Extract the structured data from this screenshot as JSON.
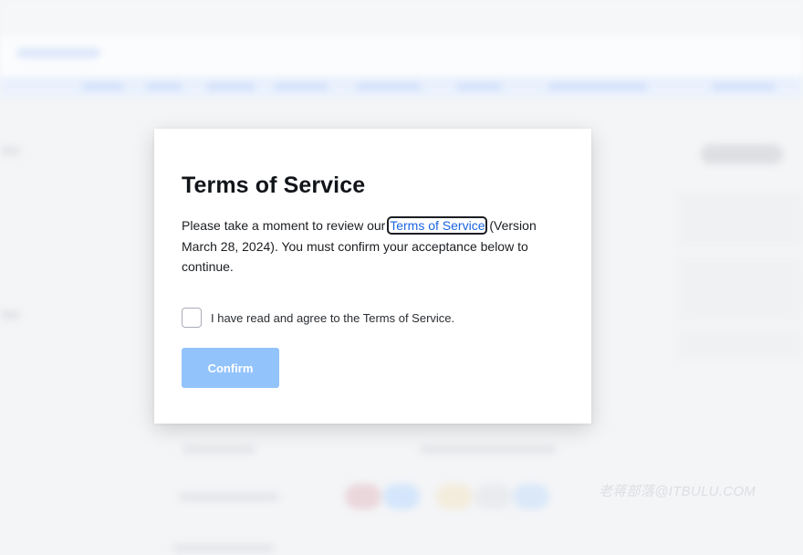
{
  "modal": {
    "title": "Terms of Service",
    "body_before": "Please take a moment to review our ",
    "link_text": "Terms of Service",
    "body_after": " (Version March 28, 2024). You must confirm your acceptance below to continue.",
    "checkbox_label": "I have read and agree to the Terms of Service.",
    "checkbox_checked": false,
    "confirm_label": "Confirm",
    "confirm_enabled": false
  },
  "watermark": "老蒋部落@ITBULU.COM",
  "colors": {
    "link": "#1a66e0",
    "confirm_disabled_bg": "#93c3fb",
    "backdrop": "#f4f5f7"
  }
}
